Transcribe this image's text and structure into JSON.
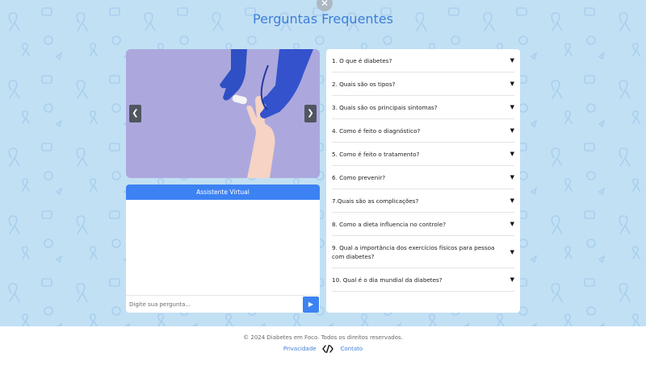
{
  "page": {
    "title": "Perguntas Frequentes"
  },
  "carousel": {
    "prev_icon": "chevron-left-icon",
    "next_icon": "chevron-right-icon",
    "prev_glyph": "❮",
    "next_glyph": "❯"
  },
  "chat": {
    "header": "Assistente Virtual",
    "placeholder": "Digite sua pergunta...",
    "send_glyph": "▶"
  },
  "faq": {
    "arrow": "▼",
    "items": [
      {
        "question": "1. O que é diabetes?"
      },
      {
        "question": "2. Quais são os tipos?"
      },
      {
        "question": "3. Quais são os principais sintomas?"
      },
      {
        "question": "4. Como é feito o diagnóstico?"
      },
      {
        "question": "5. Como é feito o tratamento?"
      },
      {
        "question": "6. Como prevenir?"
      },
      {
        "question": "7.Quais são as complicações?"
      },
      {
        "question": "8. Como a dieta influencia no controle?"
      },
      {
        "question": "9. Qual a importância dos exercícios físicos para pessoa com diabetes?"
      },
      {
        "question": "10. Qual é o dia mundial da diabetes?"
      }
    ]
  },
  "footer": {
    "copyright": "© 2024 Diabetes em Foco. Todos os direitos reservados.",
    "privacy": "Privacidade",
    "contact": "Contato"
  },
  "colors": {
    "background": "#c2e0f4",
    "accent": "#3d82f3",
    "title": "#3d7fd8"
  }
}
